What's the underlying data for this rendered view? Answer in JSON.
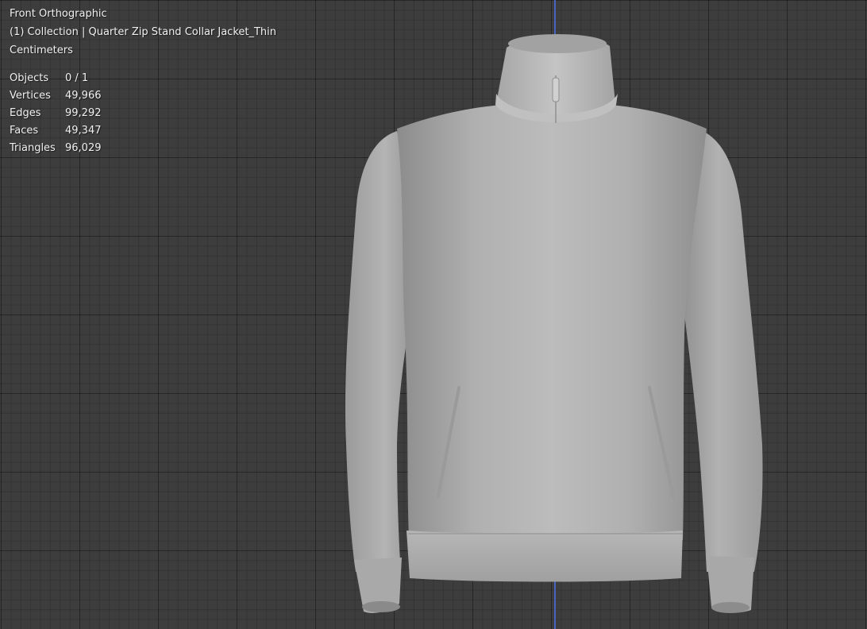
{
  "viewport": {
    "view_name": "Front Orthographic",
    "collection_line": "(1) Collection | Quarter Zip Stand Collar Jacket_Thin",
    "units": "Centimeters"
  },
  "stats": [
    {
      "label": "Objects",
      "value": "0 / 1"
    },
    {
      "label": "Vertices",
      "value": "49,966"
    },
    {
      "label": "Edges",
      "value": "99,292"
    },
    {
      "label": "Faces",
      "value": "49,347"
    },
    {
      "label": "Triangles",
      "value": "96,029"
    }
  ],
  "colors": {
    "background": "#3d3d3d",
    "grid": "#2e2e2e",
    "z_axis": "#4b6bd6",
    "mesh": "#b4b4b4"
  }
}
